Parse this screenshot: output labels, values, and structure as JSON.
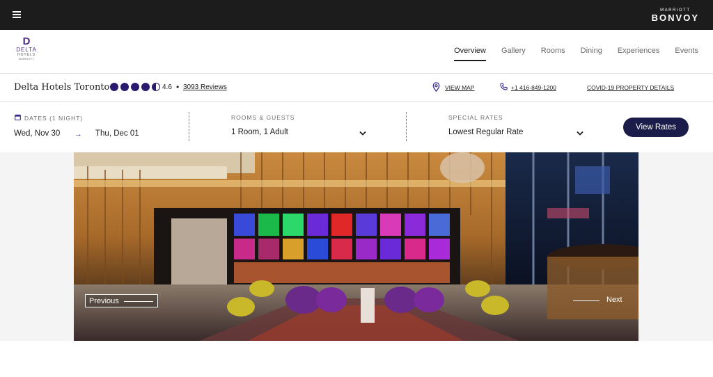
{
  "header": {
    "brand_small": "MARRIOTT",
    "brand_big": "BONVOY"
  },
  "hotel_logo": {
    "mark": "D",
    "word": "DELTA",
    "sub": "HOTELS",
    "parent": "MARRIOTT"
  },
  "nav": {
    "tabs": [
      {
        "label": "Overview",
        "active": true
      },
      {
        "label": "Gallery",
        "active": false
      },
      {
        "label": "Rooms",
        "active": false
      },
      {
        "label": "Dining",
        "active": false
      },
      {
        "label": "Experiences",
        "active": false
      },
      {
        "label": "Events",
        "active": false
      }
    ]
  },
  "hotel": {
    "name": "Delta Hotels Toronto",
    "rating": "4.6",
    "bullet": "•",
    "reviews": "3093 Reviews",
    "view_map": "VIEW MAP",
    "phone": "+1 416-849-1200",
    "covid": "COVID-19 PROPERTY DETAILS"
  },
  "booking": {
    "dates_label": "DATES (1 NIGHT)",
    "check_in": "Wed, Nov 30",
    "arrow": "→",
    "check_out": "Thu, Dec 01",
    "rooms_label": "ROOMS & GUESTS",
    "rooms_value": "1 Room, 1 Adult",
    "rates_label": "SPECIAL RATES",
    "rates_value": "Lowest Regular Rate",
    "view_rates": "View Rates"
  },
  "carousel": {
    "previous": "Previous",
    "next": "Next"
  },
  "colors": {
    "topbar": "#1c1c1c",
    "accent": "#2a1b6e",
    "button": "#1c1c4a"
  }
}
